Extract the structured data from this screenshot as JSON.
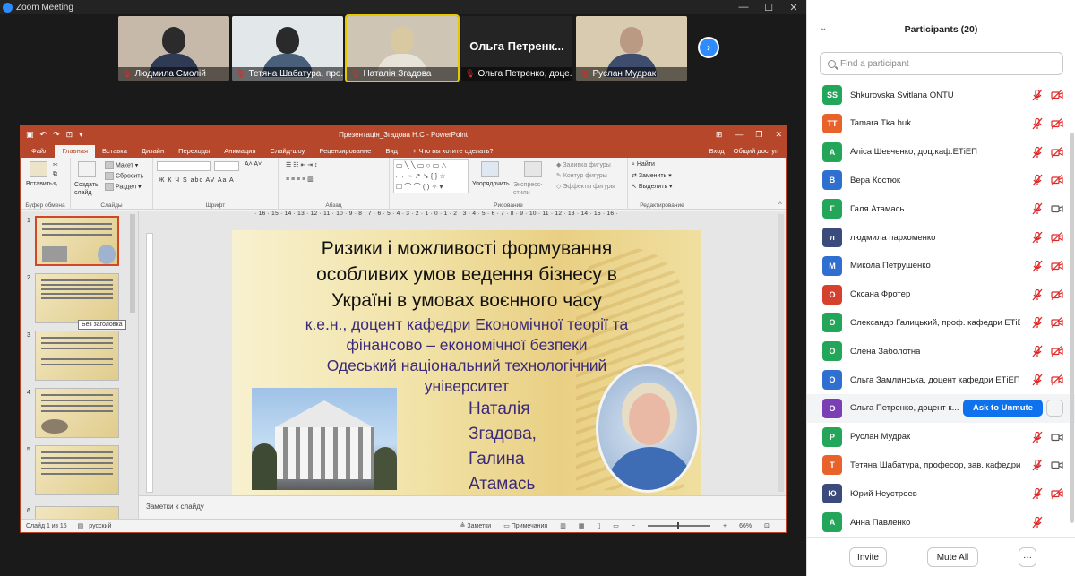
{
  "window": {
    "title": "Zoom Meeting",
    "controls": [
      "—",
      "☐",
      "✕"
    ]
  },
  "video_strip": {
    "tiles": [
      {
        "name": "Людмила Смолій",
        "muted": true,
        "bg": "#c7b9a9",
        "head": "#2b2b2b",
        "body": "#2f3a55"
      },
      {
        "name": "Тетяна Шабатура, про...",
        "muted": true,
        "bg": "#e2e7ea",
        "head": "#2a2a2a",
        "body": "#495f7a"
      },
      {
        "name": "Наталія Згадова",
        "muted": true,
        "active": true,
        "bg": "#cfc5b5",
        "head": "#d8c9a0",
        "body": "#e8e3d8"
      },
      {
        "name": "Ольга Петренко, доце...",
        "muted": true,
        "text_only": true,
        "big_text": "Ольга Петренк..."
      },
      {
        "name": "Руслан Мудрак",
        "muted": true,
        "bg": "#d8cbb0",
        "head": "#bb9a84",
        "body": "#3e4d6e"
      }
    ],
    "next_icon": "chevron-right-icon"
  },
  "powerpoint": {
    "title": "Презентація_Згадова Н.С - PowerPoint",
    "tabs": [
      "Файл",
      "Главная",
      "Вставка",
      "Дизайн",
      "Переходы",
      "Анимация",
      "Слайд-шоу",
      "Рецензирование",
      "Вид",
      "♀ Что вы хотите сделать?"
    ],
    "selected_tab": "Главная",
    "tabs_right": [
      "Вход",
      "Общий доступ"
    ],
    "ribbon": {
      "clipboard": {
        "paste": "Вставить",
        "label": "Буфер обмена"
      },
      "slides": {
        "new_slide": "Создать слайд",
        "layout": "Макет",
        "reset": "Сбросить",
        "section": "Раздел",
        "label": "Слайды"
      },
      "font": {
        "label": "Шрифт",
        "styles": "Ж К Ч S abc AV Aa A"
      },
      "paragraph": {
        "label": "Абзац"
      },
      "drawing": {
        "arrange": "Упорядочить",
        "styles": "Экспресс-стили",
        "fill": "Заливка фигуры",
        "outline": "Контур фигуры",
        "effects": "Эффекты фигуры",
        "label": "Рисование"
      },
      "editing": {
        "find": "Найти",
        "replace": "Заменить",
        "select": "Выделить",
        "label": "Редактирование"
      }
    },
    "ruler": "· 16 · 15 · 14 · 13 · 12 · 11 · 10 · 9 · 8 · 7 · 6 · 5 · 4 · 3 · 2 · 1 · 0 · 1 · 2 · 3 · 4 · 5 · 6 · 7 · 8 · 9 · 10 · 11 · 12 · 13 · 14 · 15 · 16 ·",
    "thumbnails": [
      {
        "num": "1",
        "selected": true
      },
      {
        "num": "2"
      },
      {
        "num": "3"
      },
      {
        "num": "4"
      },
      {
        "num": "5"
      },
      {
        "num": "6"
      }
    ],
    "tooltip": "Без заголовка",
    "slide": {
      "title_lines": [
        "Ризики і можливості  формування",
        "особливих умов ведення бізнесу в",
        "Україні в умовах воєнного часу"
      ],
      "subtitle_lines": [
        "к.е.н., доцент кафедри Економічної теорії та",
        "фінансово – економічної безпеки",
        "Одеський національний технологічний",
        "університет"
      ],
      "name_lines": [
        "Наталія",
        "Згадова,",
        "Галина",
        "Атамась"
      ]
    },
    "notes_placeholder": "Заметки к слайду",
    "status": {
      "slide_info": "Слайд 1 из 15",
      "language": "русский",
      "notes": "Заметки",
      "comments": "Примечания",
      "zoom": "66%"
    }
  },
  "participants_panel": {
    "title": "Participants (20)",
    "search_placeholder": "Find a participant",
    "participants": [
      {
        "initials": "SS",
        "name": "Shkurovska Svitlana ONTU",
        "color": "#23a55a",
        "mic": "muted",
        "video": "off"
      },
      {
        "initials": "TT",
        "name": "Tamara Tka huk",
        "color": "#e8632b",
        "mic": "muted",
        "video": "off"
      },
      {
        "initials": "А",
        "name": "Аліса Шевченко, доц.каф.ЕТіЕП",
        "color": "#23a55a",
        "mic": "muted",
        "video": "off"
      },
      {
        "initials": "В",
        "name": "Вера Костюк",
        "color": "#2f6fd0",
        "mic": "muted",
        "video": "off"
      },
      {
        "initials": "Г",
        "name": "Галя Атамась",
        "color": "#23a55a",
        "mic": "muted",
        "video": "on"
      },
      {
        "initials": "л",
        "name": "людмила пархоменко",
        "color": "#3b4c7c",
        "mic": "muted",
        "video": "off"
      },
      {
        "initials": "М",
        "name": "Микола Петрушенко",
        "color": "#2f6fd0",
        "mic": "muted",
        "video": "off"
      },
      {
        "initials": "О",
        "name": "Оксана Фротер",
        "color": "#d6412e",
        "mic": "muted",
        "video": "off"
      },
      {
        "initials": "О",
        "name": "Олександр Галицький, проф. кафедри ЕТіЕП",
        "color": "#23a55a",
        "mic": "muted",
        "video": "off"
      },
      {
        "initials": "О",
        "name": "Олена Заболотна",
        "color": "#23a55a",
        "mic": "muted",
        "video": "off"
      },
      {
        "initials": "О",
        "name": "Ольга Замлинська, доцент кафедри ЕТіЕП",
        "color": "#2f6fd0",
        "mic": "muted",
        "video": "off"
      },
      {
        "initials": "О",
        "name": "Ольга Петренко, доцент к...",
        "color": "#7b3fb5",
        "hover": true,
        "ask_label": "Ask to Unmute",
        "more_label": "···"
      },
      {
        "initials": "Р",
        "name": "Руслан Мудрак",
        "color": "#23a55a",
        "mic": "muted",
        "video": "on"
      },
      {
        "initials": "Т",
        "name": "Тетяна Шабатура, професор, зав. кафедри",
        "color": "#e8632b",
        "mic": "muted",
        "video": "on"
      },
      {
        "initials": "Ю",
        "name": "Юрий Неустроев",
        "color": "#3b4c7c",
        "mic": "muted",
        "video": "off"
      },
      {
        "initials": "А",
        "name": "Анна Павленко",
        "color": "#23a55a",
        "mic": "muted",
        "video": "none"
      }
    ],
    "buttons": {
      "invite": "Invite",
      "mute_all": "Mute All",
      "more": "···"
    }
  }
}
